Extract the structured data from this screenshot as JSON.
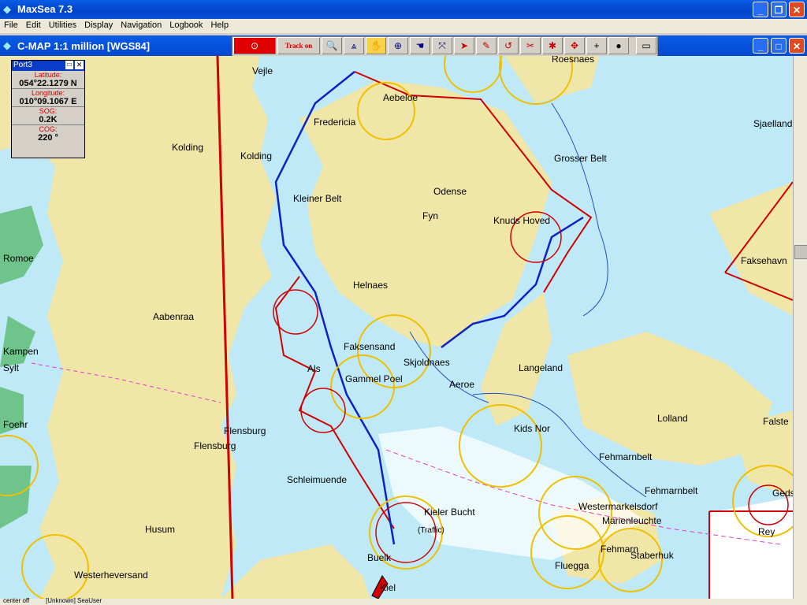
{
  "app": {
    "title": "MaxSea 7.3"
  },
  "menu": [
    "File",
    "Edit",
    "Utilities",
    "Display",
    "Navigation",
    "Logbook",
    "Help"
  ],
  "chart_window": {
    "title": "C-MAP  1:1 million [WGS84]"
  },
  "toolbar": {
    "track_label": "Track on"
  },
  "info_panel": {
    "title": "Port3",
    "latitude_label": "Latitude:",
    "latitude": "054°22.1279 N",
    "longitude_label": "Longitude:",
    "longitude": "010°09.1067 E",
    "sog_label": "SOG:",
    "sog": "0.2K",
    "cog_label": "COG:",
    "cog": "220 °"
  },
  "places": {
    "vejle": "Vejle",
    "aeroskobing": "Aebeloe",
    "fredericia": "Fredericia",
    "kolding1": "Kolding",
    "kolding2": "Kolding",
    "kleiner_belt": "Kleiner Belt",
    "odense": "Odense",
    "fyn": "Fyn",
    "grosser_belt": "Grosser Belt",
    "knuds_hoved": "Knuds Hoved",
    "sjaelland": "Sjaelland",
    "faksehavn": "Faksehavn",
    "helnaes": "Helnaes",
    "aabenraa": "Aabenraa",
    "faksensand": "Faksensand",
    "skjoldnaes": "Skjoldnaes",
    "langeland": "Langeland",
    "als": "Als",
    "gammel_poel": "Gammel Poel",
    "kampen": "Kampen",
    "sylt": "Sylt",
    "flensburg1": "Flensburg",
    "flensburg2": "Flensburg",
    "foehr": "Foehr",
    "lolland": "Lolland",
    "falster": "Falste",
    "fehmarnbelt1": "Fehmarnbelt",
    "fehmarnbelt2": "Fehmarnbelt",
    "schleimuende": "Schleimuende",
    "kieler_bucht": "Kieler Bucht",
    "marienleuchte": "Marienleuchte",
    "westermarkelsdorf": "Westermarkelsdorf",
    "husum": "Husum",
    "westerheversand": "Westerheversand",
    "fehmarn": "Fehmarn",
    "staberhuk": "Staberhuk",
    "fluegga": "Fluegga",
    "buelk": "Buelk",
    "kiel": "Kiel",
    "rey": "Rey",
    "geds": "Geds",
    "traffic": "(Traffic)",
    "roesnaes": "Roesnaes",
    "lyoe": "Aeroe",
    "bagenkop": "Kids Nor",
    "romoe": "Romoe"
  },
  "status": {
    "left": "center off",
    "middle": "[Unknown] SeaUser"
  }
}
